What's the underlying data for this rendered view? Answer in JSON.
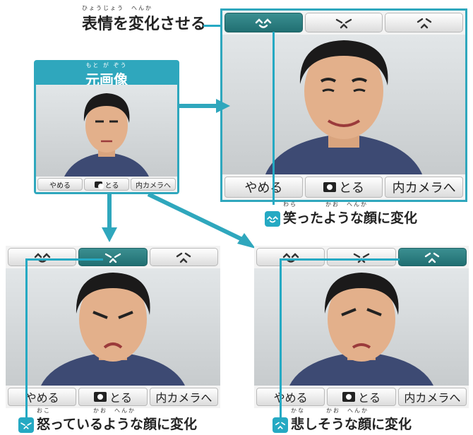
{
  "labels": {
    "change_expression": "表情を変化させる",
    "change_expression_ruby": "ひょうじょう　へんか",
    "original": "元画像",
    "original_ruby": "もと が ぞう",
    "laugh_caption": "笑ったような顔に変化",
    "laugh_ruby": "わら　　　　かお　へんか",
    "angry_caption": "怒っているような顔に変化",
    "angry_ruby": "おこ　　　　　　かお　へんか",
    "sad_caption": "悲しそうな顔に変化",
    "sad_ruby": "かな　　　かお　へんか"
  },
  "buttons": {
    "quit": "やめる",
    "take": "とる",
    "inner_camera": "内カメラへ"
  },
  "tabs": [
    {
      "icon": "laugh-face-icon"
    },
    {
      "icon": "angry-face-icon"
    },
    {
      "icon": "sad-face-icon"
    }
  ],
  "colors": {
    "accent": "#2fa7bd",
    "tab_selected": "#216f72"
  }
}
